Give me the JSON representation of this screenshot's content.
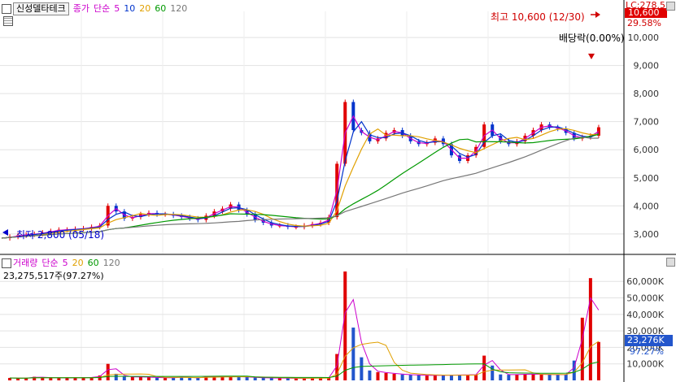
{
  "price_legend": {
    "stock_name": "신성델타테크",
    "price_type": "종가",
    "ma_type": "단순",
    "periods": [
      "5",
      "10",
      "20",
      "60",
      "120"
    ],
    "colors": [
      "#cc00cc",
      "#0033cc",
      "#e0a000",
      "#009900",
      "#777777"
    ]
  },
  "price_panel": {
    "lc_label": "LC:278.57",
    "current_price": "10,600",
    "change_pct": "29.58%",
    "high_note": "최고 10,600 (12/30)",
    "low_note": "최저 2,800 (05/18)",
    "dividend_note": "배당락(0.00%)",
    "y_ticks": [
      "10,000",
      "9,000",
      "8,000",
      "7,000",
      "6,000",
      "5,000",
      "4,000",
      "3,000"
    ]
  },
  "volume_legend": {
    "title": "거래량",
    "ma_type": "단순",
    "periods": [
      "5",
      "20",
      "60",
      "120"
    ],
    "colors": [
      "#cc00cc",
      "#e0a000",
      "#009900",
      "#777777"
    ],
    "summary": "23,275,517주(97.27%)"
  },
  "volume_panel": {
    "current_volume": "23,276K",
    "volume_pct": "97.27%",
    "y_ticks": [
      "60,000K",
      "50,000K",
      "40,000K",
      "30,000K",
      "20,000K",
      "10,000K"
    ]
  },
  "chart_data": [
    {
      "type": "line",
      "title": "",
      "xlabel": "",
      "ylabel": "",
      "ylim": [
        2300,
        10900
      ],
      "grid": true,
      "note": "price path approximated from candlestick chart",
      "x": [
        0,
        10,
        20,
        30,
        40,
        50,
        60,
        70,
        80,
        90,
        100,
        110,
        120,
        130,
        140,
        150,
        160,
        170,
        180,
        190,
        200,
        210,
        220,
        230,
        240,
        250,
        260,
        270,
        280,
        290,
        300,
        310,
        320,
        330,
        340,
        350,
        360,
        370,
        380,
        390,
        400,
        410,
        420,
        430,
        440,
        450,
        460,
        470,
        480,
        490,
        500,
        510,
        520,
        530,
        540,
        550,
        560,
        570,
        580,
        590,
        600,
        610,
        620,
        630,
        640,
        650,
        660,
        670,
        680,
        690,
        700,
        710,
        720,
        730
      ],
      "series": [
        {
          "values": [
            2850,
            2900,
            2950,
            2980,
            3000,
            3050,
            3100,
            3150,
            3150,
            3180,
            3200,
            3250,
            3300,
            4000,
            3800,
            3550,
            3600,
            3700,
            3750,
            3700,
            3700,
            3650,
            3600,
            3550,
            3500,
            3650,
            3800,
            3900,
            4050,
            3850,
            3700,
            3500,
            3400,
            3300,
            3300,
            3250,
            3250,
            3300,
            3350,
            3400,
            3600,
            5500,
            7700,
            6700,
            6600,
            6300,
            6400,
            6600,
            6700,
            6500,
            6300,
            6200,
            6250,
            6400,
            6200,
            5800,
            5600,
            5800,
            6100,
            6900,
            6500,
            6300,
            6200,
            6300,
            6500,
            6700,
            6900,
            6800,
            6750,
            6600,
            6400,
            6450,
            6500,
            6800
          ]
        }
      ]
    },
    {
      "type": "bar",
      "title": "",
      "ylim": [
        0,
        68000
      ],
      "note": "volume in thousands of shares, approximated",
      "x": [
        10,
        20,
        30,
        40,
        50,
        60,
        70,
        80,
        90,
        100,
        110,
        120,
        130,
        140,
        150,
        160,
        170,
        180,
        190,
        200,
        210,
        220,
        230,
        240,
        250,
        260,
        270,
        280,
        290,
        300,
        310,
        320,
        330,
        340,
        350,
        360,
        370,
        380,
        390,
        400,
        410,
        420,
        430,
        440,
        450,
        460,
        470,
        480,
        490,
        500,
        510,
        520,
        530,
        540,
        550,
        560,
        570,
        580,
        590,
        600,
        610,
        620,
        630,
        640,
        650,
        660,
        670,
        680,
        690,
        700,
        710,
        720,
        730
      ],
      "values": [
        1500,
        1200,
        1500,
        2200,
        1600,
        1800,
        1400,
        1600,
        1500,
        1800,
        1700,
        3000,
        10000,
        4000,
        2200,
        2000,
        2100,
        1800,
        1700,
        1500,
        1800,
        2000,
        1600,
        1500,
        2400,
        2300,
        2400,
        2200,
        2200,
        2000,
        1700,
        1600,
        1400,
        1500,
        1300,
        1200,
        1300,
        1400,
        1500,
        1600,
        16000,
        66000,
        32000,
        14000,
        6000,
        5000,
        4500,
        4000,
        3600,
        3300,
        3200,
        3000,
        3000,
        3100,
        3200,
        3300,
        3400,
        3500,
        15000,
        9000,
        3600,
        3400,
        3600,
        3800,
        3700,
        3700,
        3500,
        3400,
        3600,
        12000,
        38000,
        62000,
        23276
      ]
    }
  ]
}
